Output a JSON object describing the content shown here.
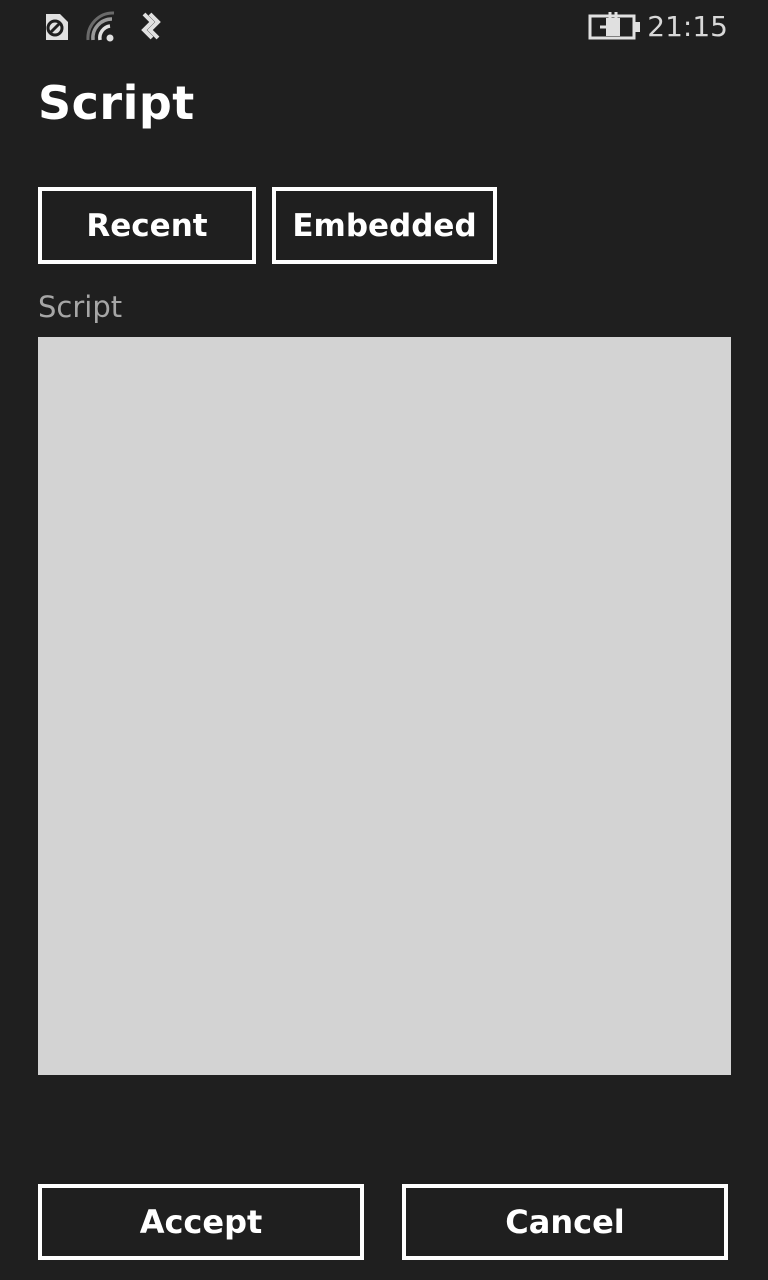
{
  "status_bar": {
    "icons": [
      "alarm-icon",
      "wifi-icon",
      "data-sync-icon",
      "battery-charging-icon"
    ],
    "time": "21:15"
  },
  "page": {
    "title": "Script"
  },
  "tabs": {
    "recent_label": "Recent",
    "embedded_label": "Embedded"
  },
  "script_field": {
    "label": "Script",
    "value": ""
  },
  "actions": {
    "accept_label": "Accept",
    "cancel_label": "Cancel"
  },
  "colors": {
    "background": "#1f1f1f",
    "text_box": "#d3d3d3",
    "label_gray": "#a6a6a6",
    "foreground": "#ffffff"
  }
}
